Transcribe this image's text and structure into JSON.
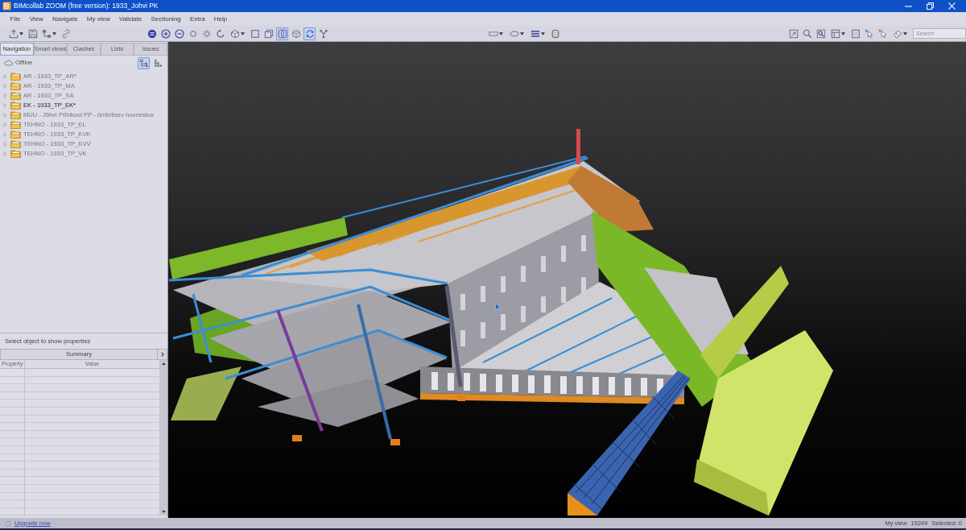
{
  "window": {
    "title": "BIMcollab ZOOM (free version): 1933_Johvi PK"
  },
  "menu": [
    "File",
    "View",
    "Navigate",
    "My view",
    "Validate",
    "Sectioning",
    "Extra",
    "Help"
  ],
  "toolbar": {
    "view_tools": [
      {
        "selected": false
      },
      {
        "selected": false
      },
      {
        "selected": false
      },
      {
        "selected": false
      },
      {
        "selected": false
      },
      {
        "selected": false
      },
      {
        "selected": false
      },
      {
        "selected": false
      },
      {
        "selected": false
      },
      {
        "selected": true
      },
      {
        "selected": false
      },
      {
        "selected": true
      },
      {
        "selected": false
      }
    ],
    "search": {
      "placeholder": "Search"
    }
  },
  "left_panel": {
    "tabs": [
      {
        "label": "Navigation",
        "selected": true
      },
      {
        "label": "Smart views",
        "selected": false
      },
      {
        "label": "Clashes",
        "selected": false
      },
      {
        "label": "Lists",
        "selected": false
      },
      {
        "label": "Issues",
        "selected": false
      }
    ],
    "connection": "Offline",
    "view_toggles": [
      {
        "selected": true
      },
      {
        "selected": false
      }
    ],
    "models": [
      {
        "label": "AR - 1933_TP_AR*",
        "expanded": false,
        "disabled": true
      },
      {
        "label": "AR - 1933_TP_MA",
        "expanded": false,
        "disabled": true
      },
      {
        "label": "AR - 1933_TP_SA",
        "expanded": false,
        "disabled": true
      },
      {
        "label": "EK - 1933_TP_EK*",
        "expanded": false,
        "disabled": false
      },
      {
        "label": "MUU - Jõhvi Põhikool PP - ümbritsev hoonestus",
        "expanded": false,
        "disabled": true
      },
      {
        "label": "TEHNO - 1933_TP_EL",
        "expanded": false,
        "disabled": true
      },
      {
        "label": "TEHNO - 1933_TP_KVK",
        "expanded": false,
        "disabled": true
      },
      {
        "label": "TEHNO - 1933_TP_KVV",
        "expanded": false,
        "disabled": true
      },
      {
        "label": "TEHNO - 1933_TP_VK",
        "expanded": false,
        "disabled": true
      }
    ]
  },
  "properties": {
    "hint": "Select object to show properties",
    "summary": "Summary",
    "columns": [
      "Property",
      "Value"
    ]
  },
  "status_bar": {
    "link": "Upgrade now",
    "view": "My view",
    "count": "15249",
    "selected": "Selected: 0"
  }
}
